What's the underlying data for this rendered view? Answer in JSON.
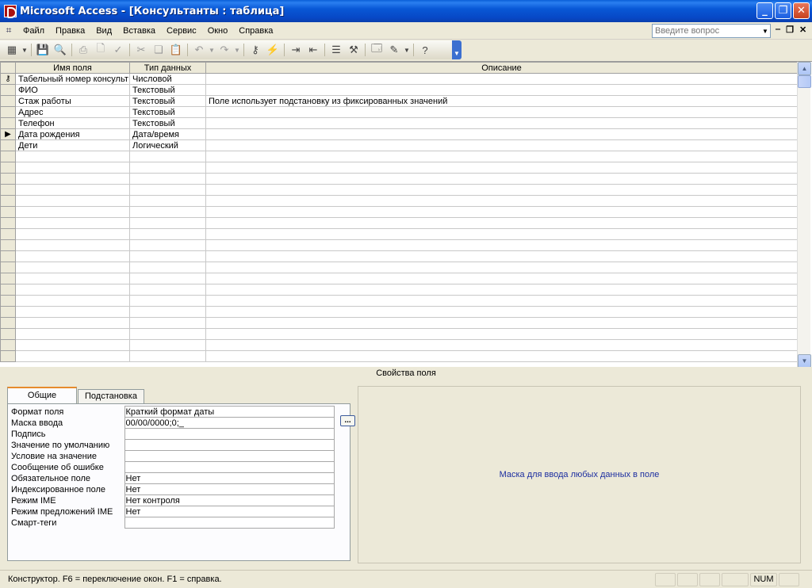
{
  "window": {
    "title": "Microsoft Access - [Консультанты : таблица]"
  },
  "menu": {
    "items": [
      {
        "label": "Файл"
      },
      {
        "label": "Правка"
      },
      {
        "label": "Вид"
      },
      {
        "label": "Вставка"
      },
      {
        "label": "Сервис"
      },
      {
        "label": "Окно"
      },
      {
        "label": "Справка"
      }
    ],
    "ask_placeholder": "Введите вопрос"
  },
  "grid": {
    "columns": [
      "Имя поля",
      "Тип данных",
      "Описание"
    ],
    "rows": [
      {
        "name": "Табельный номер консульт",
        "type": "Числовой",
        "description": "",
        "key": true
      },
      {
        "name": "ФИО",
        "type": "Текстовый",
        "description": ""
      },
      {
        "name": "Стаж работы",
        "type": "Текстовый",
        "description": "Поле использует подстановку из фиксированных значений"
      },
      {
        "name": "Адрес",
        "type": "Текстовый",
        "description": ""
      },
      {
        "name": "Телефон",
        "type": "Текстовый",
        "description": ""
      },
      {
        "name": "Дата рождения",
        "type": "Дата/время",
        "description": "",
        "current": true
      },
      {
        "name": "Дети",
        "type": "Логический",
        "description": ""
      }
    ]
  },
  "properties": {
    "title": "Свойства поля",
    "tabs": [
      "Общие",
      "Подстановка"
    ],
    "rows": [
      {
        "name": "Формат поля",
        "value": "Краткий формат даты"
      },
      {
        "name": "Маска ввода",
        "value": "00/00/0000;0;_"
      },
      {
        "name": "Подпись",
        "value": ""
      },
      {
        "name": "Значение по умолчанию",
        "value": ""
      },
      {
        "name": "Условие на значение",
        "value": ""
      },
      {
        "name": "Сообщение об ошибке",
        "value": ""
      },
      {
        "name": "Обязательное поле",
        "value": "Нет"
      },
      {
        "name": "Индексированное поле",
        "value": "Нет"
      },
      {
        "name": "Режим IME",
        "value": "Нет контроля"
      },
      {
        "name": "Режим предложений IME",
        "value": "Нет"
      },
      {
        "name": "Смарт-теги",
        "value": ""
      }
    ],
    "hint": "Маска для ввода любых данных в поле"
  },
  "status": {
    "text": "Конструктор.  F6 = переключение окон.  F1 = справка.",
    "num": "NUM"
  }
}
